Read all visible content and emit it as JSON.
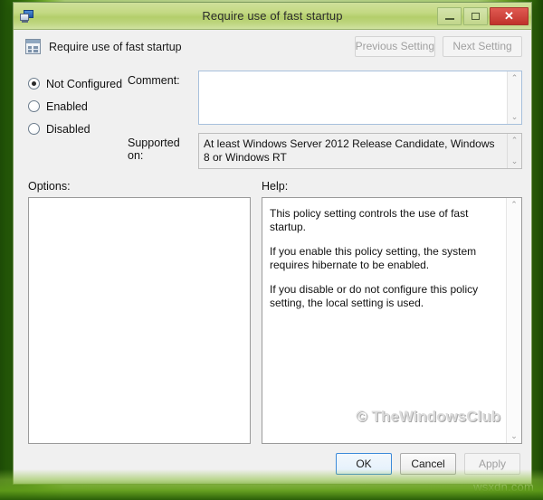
{
  "window": {
    "title": "Require use of fast startup",
    "icon": "group-policy-icon",
    "controls": {
      "minimize": "–",
      "maximize": "□",
      "close": "✕"
    }
  },
  "header": {
    "policy_icon": "policy-setting-icon",
    "policy_name": "Require use of fast startup",
    "previous_setting": "Previous Setting",
    "next_setting": "Next Setting"
  },
  "state_options": [
    {
      "label": "Not Configured",
      "selected": true
    },
    {
      "label": "Enabled",
      "selected": false
    },
    {
      "label": "Disabled",
      "selected": false
    }
  ],
  "fields": {
    "comment_label": "Comment:",
    "comment_value": "",
    "supported_label": "Supported on:",
    "supported_value": "At least Windows Server 2012 Release Candidate, Windows 8 or Windows RT"
  },
  "panes": {
    "options_label": "Options:",
    "help_label": "Help:",
    "options_content": "",
    "help_paragraphs": [
      "This policy setting controls the use of fast startup.",
      "If you enable this policy setting, the system requires hibernate to be enabled.",
      "If you disable or do not configure this policy setting, the local setting is used."
    ],
    "watermark": "© TheWindowsClub"
  },
  "footer": {
    "ok": "OK",
    "cancel": "Cancel",
    "apply": "Apply"
  },
  "overlay": {
    "source_watermark": "wsxdn.com"
  },
  "scroll_glyphs": {
    "up": "⌃",
    "down": "⌄"
  },
  "colors": {
    "titlebar_green": "#c3d983",
    "close_red": "#c0332b",
    "desktop_green": "#4e9314",
    "default_button_border": "#3c8ad9"
  }
}
